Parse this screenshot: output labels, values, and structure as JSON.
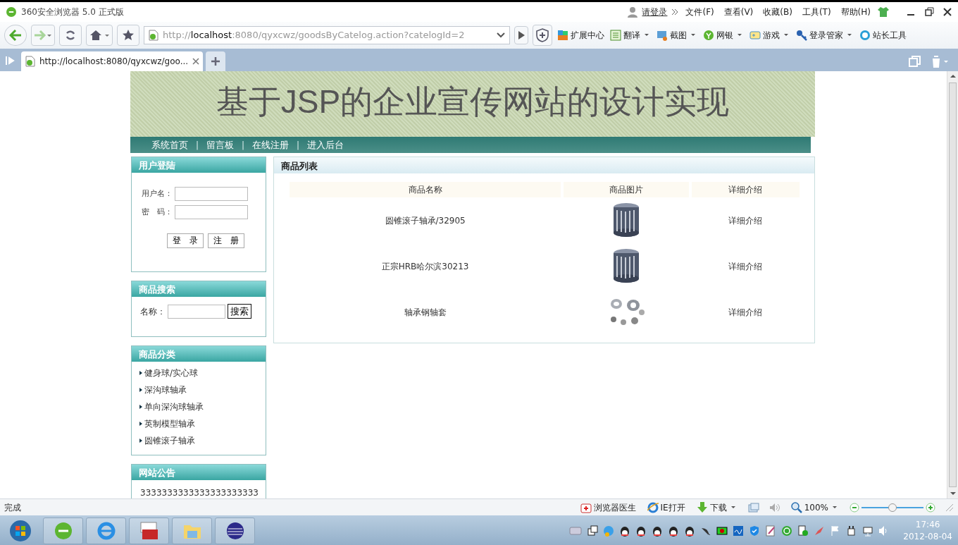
{
  "window": {
    "title": "360安全浏览器 5.0 正式版",
    "login_link": "请登录",
    "menus": [
      "文件(F)",
      "查看(V)",
      "收藏(B)",
      "工具(T)",
      "帮助(H)"
    ]
  },
  "address": {
    "url": "http://**localhost**:8080/qyxcwz/goodsByCatelog.action?catelogId=2"
  },
  "toolbar": [
    {
      "label": "扩展中心",
      "dropdown": false
    },
    {
      "label": "翻译",
      "dropdown": true
    },
    {
      "label": "截图",
      "dropdown": true
    },
    {
      "label": "网银",
      "dropdown": true
    },
    {
      "label": "游戏",
      "dropdown": true
    },
    {
      "label": "登录管家",
      "dropdown": true
    },
    {
      "label": "站长工具",
      "dropdown": false
    }
  ],
  "tabs": [
    {
      "label": "http://localhost:8080/qyxcwz/goo...",
      "selected": true
    }
  ],
  "page": {
    "banner_title": "基于JSP的企业宣传网站的设计实现",
    "nav": [
      {
        "kind": "link",
        "label": "系统首页"
      },
      {
        "kind": "separator",
        "label": "|"
      },
      {
        "kind": "link",
        "label": "留言板"
      },
      {
        "kind": "separator",
        "label": "|"
      },
      {
        "kind": "link",
        "label": "在线注册"
      },
      {
        "kind": "separator",
        "label": "|"
      },
      {
        "kind": "link",
        "label": "进入后台"
      }
    ],
    "login": {
      "title": "用户登陆",
      "username_label": "用户名：",
      "password_label": "密　码：",
      "buttons": [
        "登　录",
        "注　册"
      ]
    },
    "search": {
      "title": "商品搜索",
      "label": "名称：",
      "button": "搜索"
    },
    "categories": {
      "title": "商品分类",
      "items": [
        "健身球/实心球",
        "深沟球轴承",
        "单向深沟球轴承",
        "英制模型轴承",
        "圆锥滚子轴承"
      ]
    },
    "notice": {
      "title": "网站公告",
      "text": "3333333333333333333333"
    },
    "goods": {
      "title": "商品列表",
      "columns": [
        "商品名称",
        "商品图片",
        "详细介绍"
      ],
      "rows": [
        {
          "name": "圆锥滚子轴承/32905",
          "link": "详细介绍"
        },
        {
          "name": "正宗HRB哈尔滨30213",
          "link": "详细介绍"
        },
        {
          "name": "轴承钢轴套",
          "link": "详细介绍"
        }
      ]
    }
  },
  "status_bar": {
    "text": "完成",
    "items": [
      "浏览器医生",
      "IE打开",
      "下载"
    ],
    "zoom": "100%",
    "zoom_slider": {
      "level": 0.5
    }
  },
  "taskbar": {
    "time": "17:46",
    "date": "2012-08-04"
  }
}
